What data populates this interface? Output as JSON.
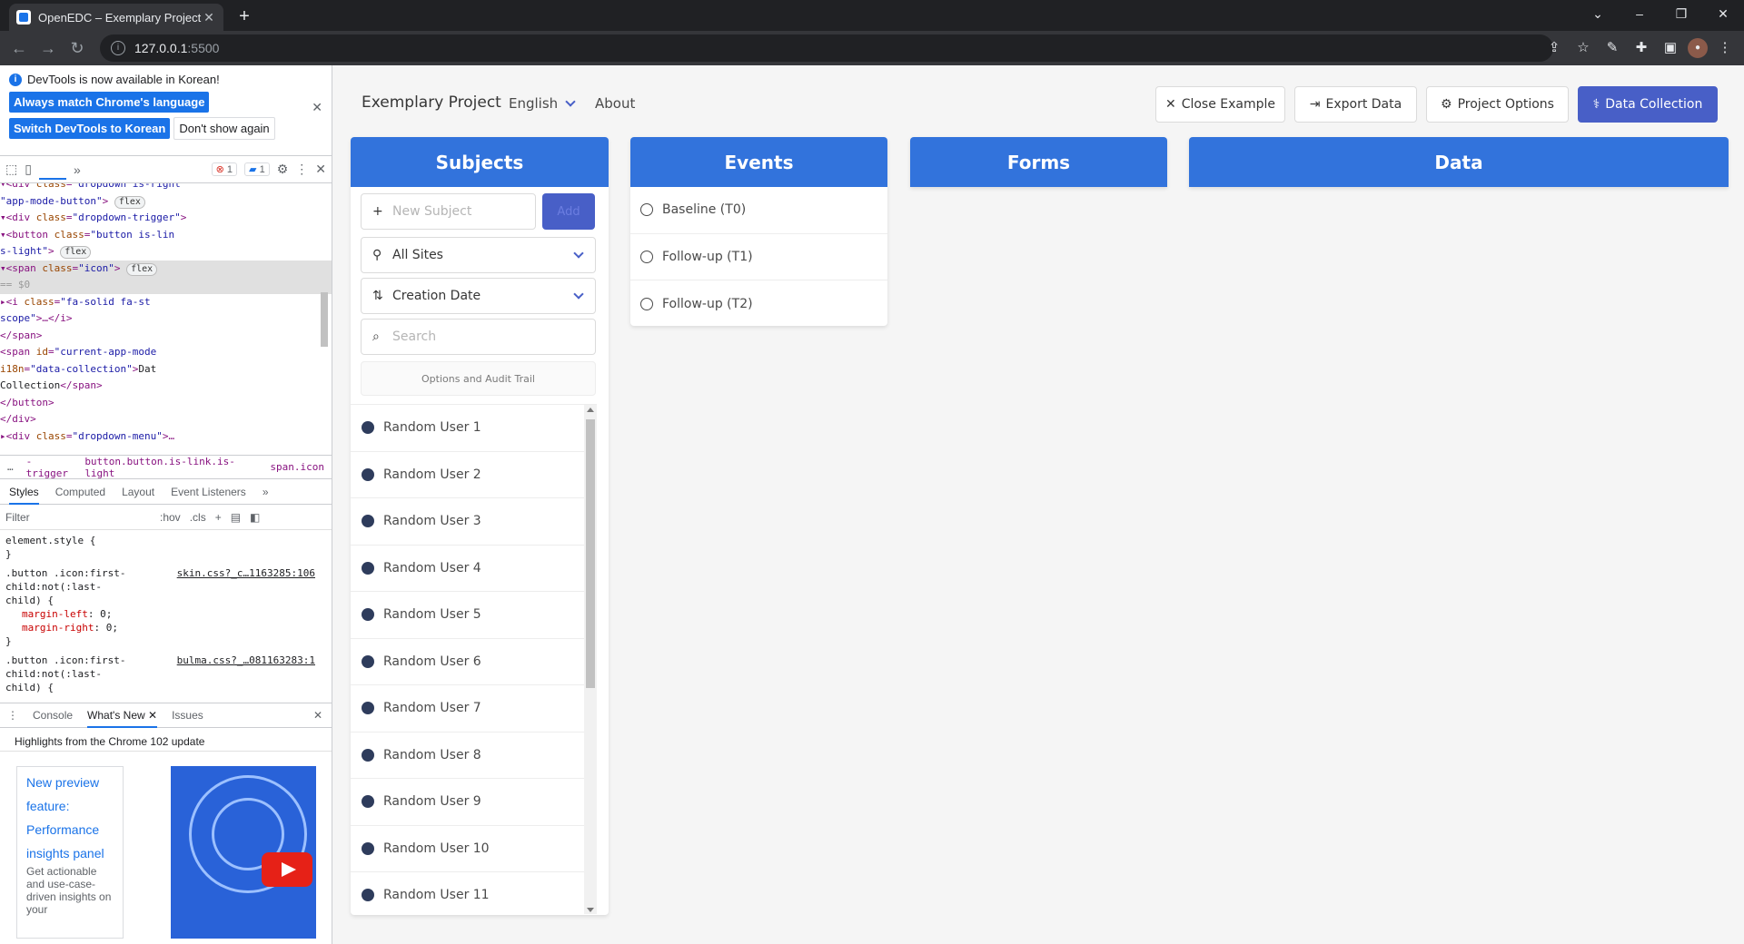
{
  "browser": {
    "tab_title": "OpenEDC – Exemplary Project",
    "url_host": "127.0.0.1",
    "url_port": ":5500"
  },
  "devtools": {
    "info_message": "DevTools is now available in Korean!",
    "btn_match": "Always match Chrome's language",
    "btn_switch": "Switch DevTools to Korean",
    "btn_dont_show": "Don't show again",
    "error_count": "1",
    "message_count": "1",
    "flex_badge": "flex",
    "crumbs": [
      "-trigger",
      "button.button.is-link.is-light",
      "span.icon"
    ],
    "styles_tabs": [
      "Styles",
      "Computed",
      "Layout",
      "Event Listeners"
    ],
    "filter_placeholder": "Filter",
    "hov": ":hov",
    "cls": ".cls",
    "source1": "skin.css?_c…1163285:106",
    "source2": "bulma.css?_…081163283:1",
    "drawer_tabs": [
      "Console",
      "What's New",
      "Issues"
    ],
    "whats_new_title": "Highlights from the Chrome 102 update",
    "wn_h1": "New preview",
    "wn_h2": "feature:",
    "wn_h3": "Performance",
    "wn_h4": "insights panel",
    "wn_desc": "Get actionable and use-case-driven insights on your"
  },
  "app": {
    "brand": "Exemplary Project",
    "language": "English",
    "about": "About",
    "btn_close": "Close Example",
    "btn_export": "Export Data",
    "btn_options": "Project Options",
    "btn_collection": "Data Collection",
    "col_subjects": "Subjects",
    "col_events": "Events",
    "col_forms": "Forms",
    "col_data": "Data",
    "new_subject_placeholder": "New Subject",
    "add_label": "Add",
    "site_filter": "All Sites",
    "sort_order": "Creation Date",
    "search_placeholder": "Search",
    "options_audit": "Options and Audit Trail",
    "subjects": [
      "Random User 1",
      "Random User 2",
      "Random User 3",
      "Random User 4",
      "Random User 5",
      "Random User 6",
      "Random User 7",
      "Random User 8",
      "Random User 9",
      "Random User 10",
      "Random User 11"
    ],
    "events": [
      "Baseline (T0)",
      "Follow-up (T1)",
      "Follow-up (T2)"
    ],
    "accent": "#3273dc",
    "primary": "#485fc7"
  }
}
